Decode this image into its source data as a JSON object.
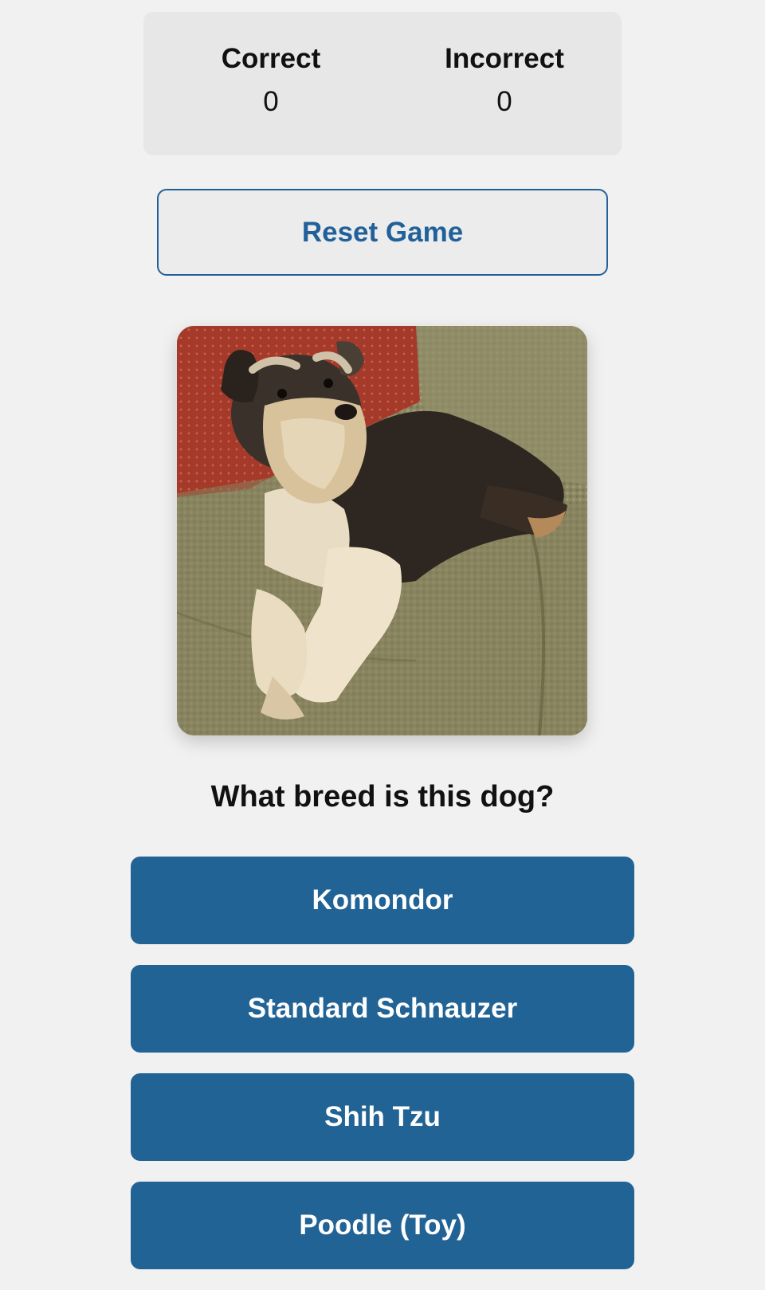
{
  "scoreboard": {
    "correct_label": "Correct",
    "correct_value": "0",
    "incorrect_label": "Incorrect",
    "incorrect_value": "0"
  },
  "reset_button": {
    "label": "Reset Game"
  },
  "dog_image": {
    "subject": "Miniature Schnauzer lying on a green couch"
  },
  "question": "What breed is this dog?",
  "options": [
    {
      "label": "Komondor"
    },
    {
      "label": "Standard Schnauzer"
    },
    {
      "label": "Shih Tzu"
    },
    {
      "label": "Poodle (Toy)"
    }
  ],
  "colors": {
    "primary": "#226395",
    "panel": "#e7e7e7",
    "background": "#f1f1f1"
  }
}
